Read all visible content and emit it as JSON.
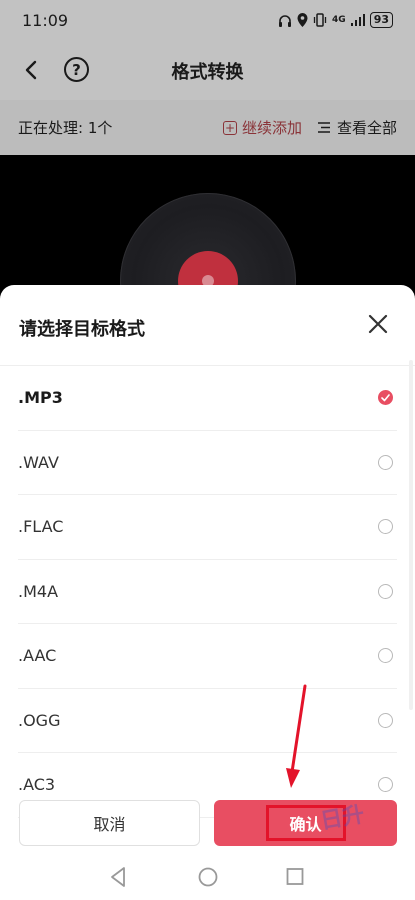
{
  "status": {
    "time": "11:09",
    "network": "4G",
    "battery": "93"
  },
  "nav": {
    "title": "格式转换"
  },
  "processing": {
    "label": "正在处理: 1个",
    "add_more": "继续添加",
    "view_all": "查看全部"
  },
  "sheet": {
    "title": "请选择目标格式",
    "formats": [
      {
        "label": ".MP3",
        "selected": true
      },
      {
        "label": ".WAV",
        "selected": false
      },
      {
        "label": ".FLAC",
        "selected": false
      },
      {
        "label": ".M4A",
        "selected": false
      },
      {
        "label": ".AAC",
        "selected": false
      },
      {
        "label": ".OGG",
        "selected": false
      },
      {
        "label": ".AC3",
        "selected": false
      }
    ],
    "cancel_label": "取消",
    "confirm_label": "确认"
  },
  "colors": {
    "accent": "#e84e62",
    "annotation": "#e3132a"
  },
  "icons": {
    "back": "back-arrow-icon",
    "help": "question-circle-icon",
    "add": "plus-square-icon",
    "list": "list-icon",
    "close": "close-icon"
  }
}
